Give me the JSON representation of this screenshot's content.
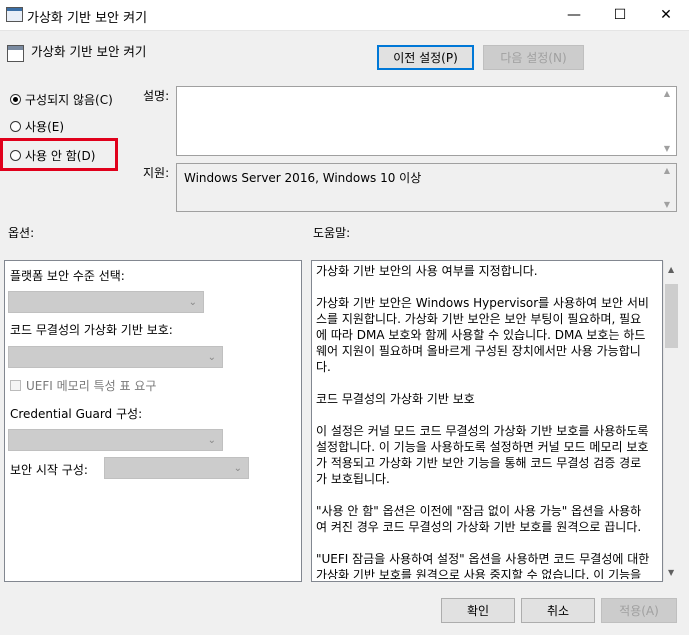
{
  "window": {
    "title": "가상화 기반 보안 켜기",
    "minimize": "—",
    "maximize": "☐",
    "close": "✕"
  },
  "header": {
    "policy_title": "가상화 기반 보안 켜기",
    "prev_button": "이전 설정(P)",
    "next_button": "다음 설정(N)"
  },
  "state": {
    "options": [
      {
        "label": "구성되지 않음(C)",
        "checked": true
      },
      {
        "label": "사용(E)",
        "checked": false
      },
      {
        "label": "사용 안 함(D)",
        "checked": false
      }
    ]
  },
  "comment": {
    "label": "설명:",
    "value": ""
  },
  "supported": {
    "label": "지원:",
    "value": "Windows Server 2016, Windows 10 이상"
  },
  "options_panel": {
    "label": "옵션:",
    "platform_label": "플랫폼 보안 수준 선택:",
    "vbs_code_integrity_label": "코드 무결성의 가상화 기반 보호:",
    "uefi_checkbox_label": "UEFI 메모리 특성 표 요구",
    "credential_guard_label": "Credential  Guard 구성:",
    "secure_launch_label": "보안 시작 구성:"
  },
  "help_panel": {
    "label": "도움말:",
    "paragraphs": [
      "가상화 기반 보안의 사용 여부를 지정합니다.",
      "가상화 기반 보안은 Windows Hypervisor를 사용하여 보안 서비스를 지원합니다. 가상화 기반 보안은 보안 부팅이 필요하며, 필요에 따라 DMA 보호와 함께 사용할 수 있습니다. DMA 보호는 하드웨어 지원이 필요하며 올바르게 구성된 장치에서만 사용 가능합니다.",
      "코드 무결성의 가상화 기반 보호",
      "이 설정은 커널 모드 코드 무결성의 가상화 기반 보호를 사용하도록 설정합니다. 이 기능을 사용하도록 설정하면 커널 모드 메모리 보호가 적용되고 가상화 기반 보안 기능을 통해 코드 무결성 검증 경로가 보호됩니다.",
      "\"사용 안 함\" 옵션은 이전에 \"잠금 없이 사용 가능\" 옵션을 사용하여 켜진 경우 코드 무결성의 가상화 기반 보호를 원격으로 끕니다.",
      "\"UEFI 잠금을 사용하여 설정\" 옵션을 사용하면 코드 무결성에 대한 가상화 기반 보호를 원격으로 사용 중지할 수 없습니다. 이 기능을 사용하지 않도록 설정하려면 그룹 정책을 \"사용 안 함\"으로"
    ]
  },
  "footer": {
    "ok": "확인",
    "cancel": "취소",
    "apply": "적용(A)"
  }
}
